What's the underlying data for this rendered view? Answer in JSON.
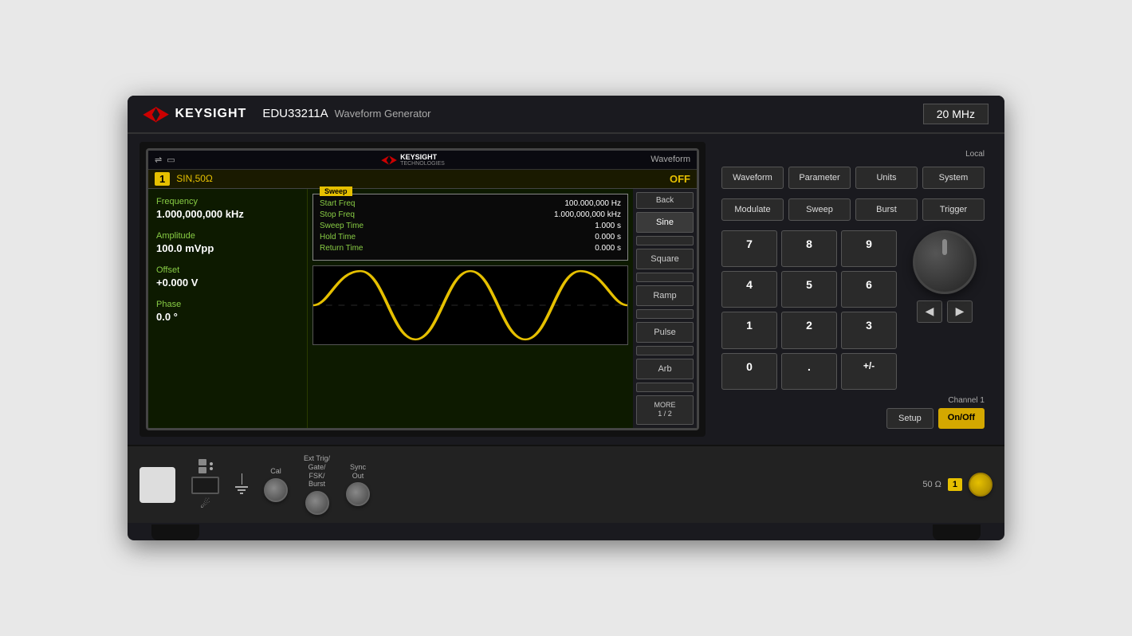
{
  "instrument": {
    "brand": "KEYSIGHT",
    "model": "EDU33211A",
    "subtitle": "Waveform Generator",
    "frequency": "20 MHz"
  },
  "screen": {
    "usb_icon": "⇌",
    "display_icon": "▭",
    "keysight_text": "KEYSIGHT",
    "keysight_sub": "TECHNOLOGIES",
    "waveform_label": "Waveform",
    "channel_num": "1",
    "channel_config": "SIN,50Ω",
    "channel_off": "OFF",
    "params": {
      "frequency_label": "Frequency",
      "frequency_value": "1.000,000,000 kHz",
      "amplitude_label": "Amplitude",
      "amplitude_value": "100.0 mVpp",
      "offset_label": "Offset",
      "offset_value": "+0.000 V",
      "phase_label": "Phase",
      "phase_value": "0.0 °"
    },
    "sweep": {
      "tab_label": "Sweep",
      "start_freq_label": "Start Freq",
      "start_freq_value": "100.000,000 Hz",
      "stop_freq_label": "Stop Freq",
      "stop_freq_value": "1.000,000,000 kHz",
      "sweep_time_label": "Sweep Time",
      "sweep_time_value": "1.000 s",
      "hold_time_label": "Hold Time",
      "hold_time_value": "0.000 s",
      "return_time_label": "Return Time",
      "return_time_value": "0.000 s"
    },
    "waveform_buttons": [
      {
        "label": "Sine",
        "active": true
      },
      {
        "label": "Square",
        "active": false
      },
      {
        "label": "Ramp",
        "active": false
      },
      {
        "label": "Pulse",
        "active": false
      },
      {
        "label": "Arb",
        "active": false
      },
      {
        "label": "MORE\n1 / 2",
        "active": false
      }
    ],
    "back_label": "Back"
  },
  "controls": {
    "local_label": "Local",
    "row1": [
      {
        "label": "Waveform",
        "active": false
      },
      {
        "label": "Parameter",
        "active": false
      },
      {
        "label": "Units",
        "active": false
      },
      {
        "label": "System",
        "active": false
      }
    ],
    "row2": [
      {
        "label": "Modulate",
        "active": false
      },
      {
        "label": "Sweep",
        "active": false
      },
      {
        "label": "Burst",
        "active": false
      },
      {
        "label": "Trigger",
        "active": false
      }
    ],
    "numpad": [
      "7",
      "8",
      "9",
      "4",
      "5",
      "6",
      "1",
      "2",
      "3",
      "0",
      ".",
      "+/-"
    ],
    "channel1_label": "Channel 1",
    "setup_label": "Setup",
    "onoff_label": "On/Off"
  },
  "bottom": {
    "cal_label": "Cal",
    "ext_trig_label": "Ext Trig/\nGate/\nFSK/\nBurst",
    "sync_out_label": "Sync\nOut",
    "ohm_label": "50 Ω",
    "ch1_label": "1"
  }
}
